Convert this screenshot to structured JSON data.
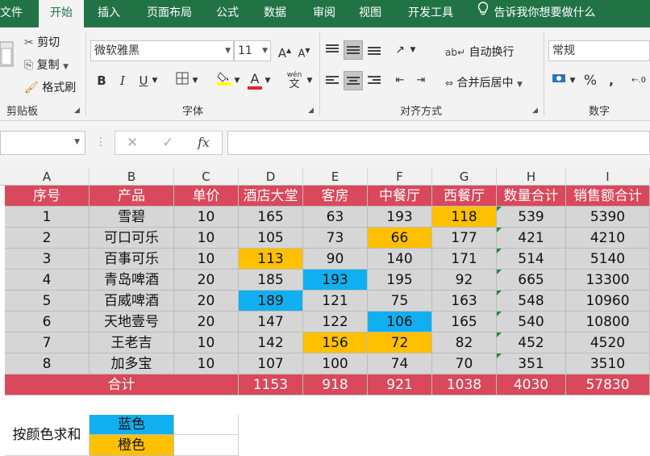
{
  "ribbon_tabs": [
    "文件",
    "开始",
    "插入",
    "页面布局",
    "公式",
    "数据",
    "审阅",
    "视图",
    "开发工具"
  ],
  "tell_me": "告诉我你想要做什么",
  "clipboard": {
    "cut": "剪切",
    "copy": "复制",
    "format_painter": "格式刷",
    "group": "剪贴板"
  },
  "font": {
    "name": "微软雅黑",
    "size": "11",
    "grow": "A",
    "shrink": "A",
    "bold": "B",
    "italic": "I",
    "underline": "U",
    "font_color": "A",
    "phonetic_top": "wén",
    "phonetic_bottom": "文",
    "group": "字体"
  },
  "alignment": {
    "wrap": "自动换行",
    "merge": "合并后居中",
    "group": "对齐方式"
  },
  "number": {
    "format": "常规",
    "percent": "%",
    "comma": ",",
    "group": "数字"
  },
  "formula_bar": {
    "name_box": "",
    "fx": "fx",
    "cancel": "✕",
    "enter": "✓",
    "value": ""
  },
  "columns": [
    "A",
    "B",
    "C",
    "D",
    "E",
    "F",
    "G",
    "H",
    "I"
  ],
  "table": {
    "headers": [
      "序号",
      "产品",
      "单价",
      "酒店大堂",
      "客房",
      "中餐厅",
      "西餐厅",
      "数量合计",
      "销售额合计"
    ],
    "rows": [
      [
        "1",
        "雪碧",
        "10",
        "165",
        "63",
        "193",
        "118",
        "539",
        "5390"
      ],
      [
        "2",
        "可口可乐",
        "10",
        "105",
        "73",
        "66",
        "177",
        "421",
        "4210"
      ],
      [
        "3",
        "百事可乐",
        "10",
        "113",
        "90",
        "140",
        "171",
        "514",
        "5140"
      ],
      [
        "4",
        "青岛啤酒",
        "20",
        "185",
        "193",
        "195",
        "92",
        "665",
        "13300"
      ],
      [
        "5",
        "百威啤酒",
        "20",
        "189",
        "121",
        "75",
        "163",
        "548",
        "10960"
      ],
      [
        "6",
        "天地壹号",
        "20",
        "147",
        "122",
        "106",
        "165",
        "540",
        "10800"
      ],
      [
        "7",
        "王老吉",
        "10",
        "142",
        "156",
        "72",
        "82",
        "452",
        "4520"
      ],
      [
        "8",
        "加多宝",
        "10",
        "107",
        "100",
        "74",
        "70",
        "351",
        "3510"
      ]
    ],
    "highlights": [
      {
        "row": 0,
        "col": 6,
        "color": "orange"
      },
      {
        "row": 1,
        "col": 5,
        "color": "orange"
      },
      {
        "row": 2,
        "col": 3,
        "color": "orange"
      },
      {
        "row": 3,
        "col": 4,
        "color": "blue"
      },
      {
        "row": 4,
        "col": 3,
        "color": "blue"
      },
      {
        "row": 5,
        "col": 5,
        "color": "blue"
      },
      {
        "row": 6,
        "col": 4,
        "color": "orange"
      },
      {
        "row": 6,
        "col": 5,
        "color": "orange"
      }
    ],
    "total": {
      "label": "合计",
      "values": [
        "1153",
        "918",
        "921",
        "1038",
        "4030",
        "57830"
      ]
    }
  },
  "sum_by_color": {
    "label": "按颜色求和",
    "blue": "蓝色",
    "orange": "橙色"
  },
  "colors": {
    "ribbon_green": "#217346",
    "header_red": "#d9485b",
    "body_gray": "#d6d6d6",
    "blue": "#10b0f0",
    "orange": "#ffc000"
  }
}
